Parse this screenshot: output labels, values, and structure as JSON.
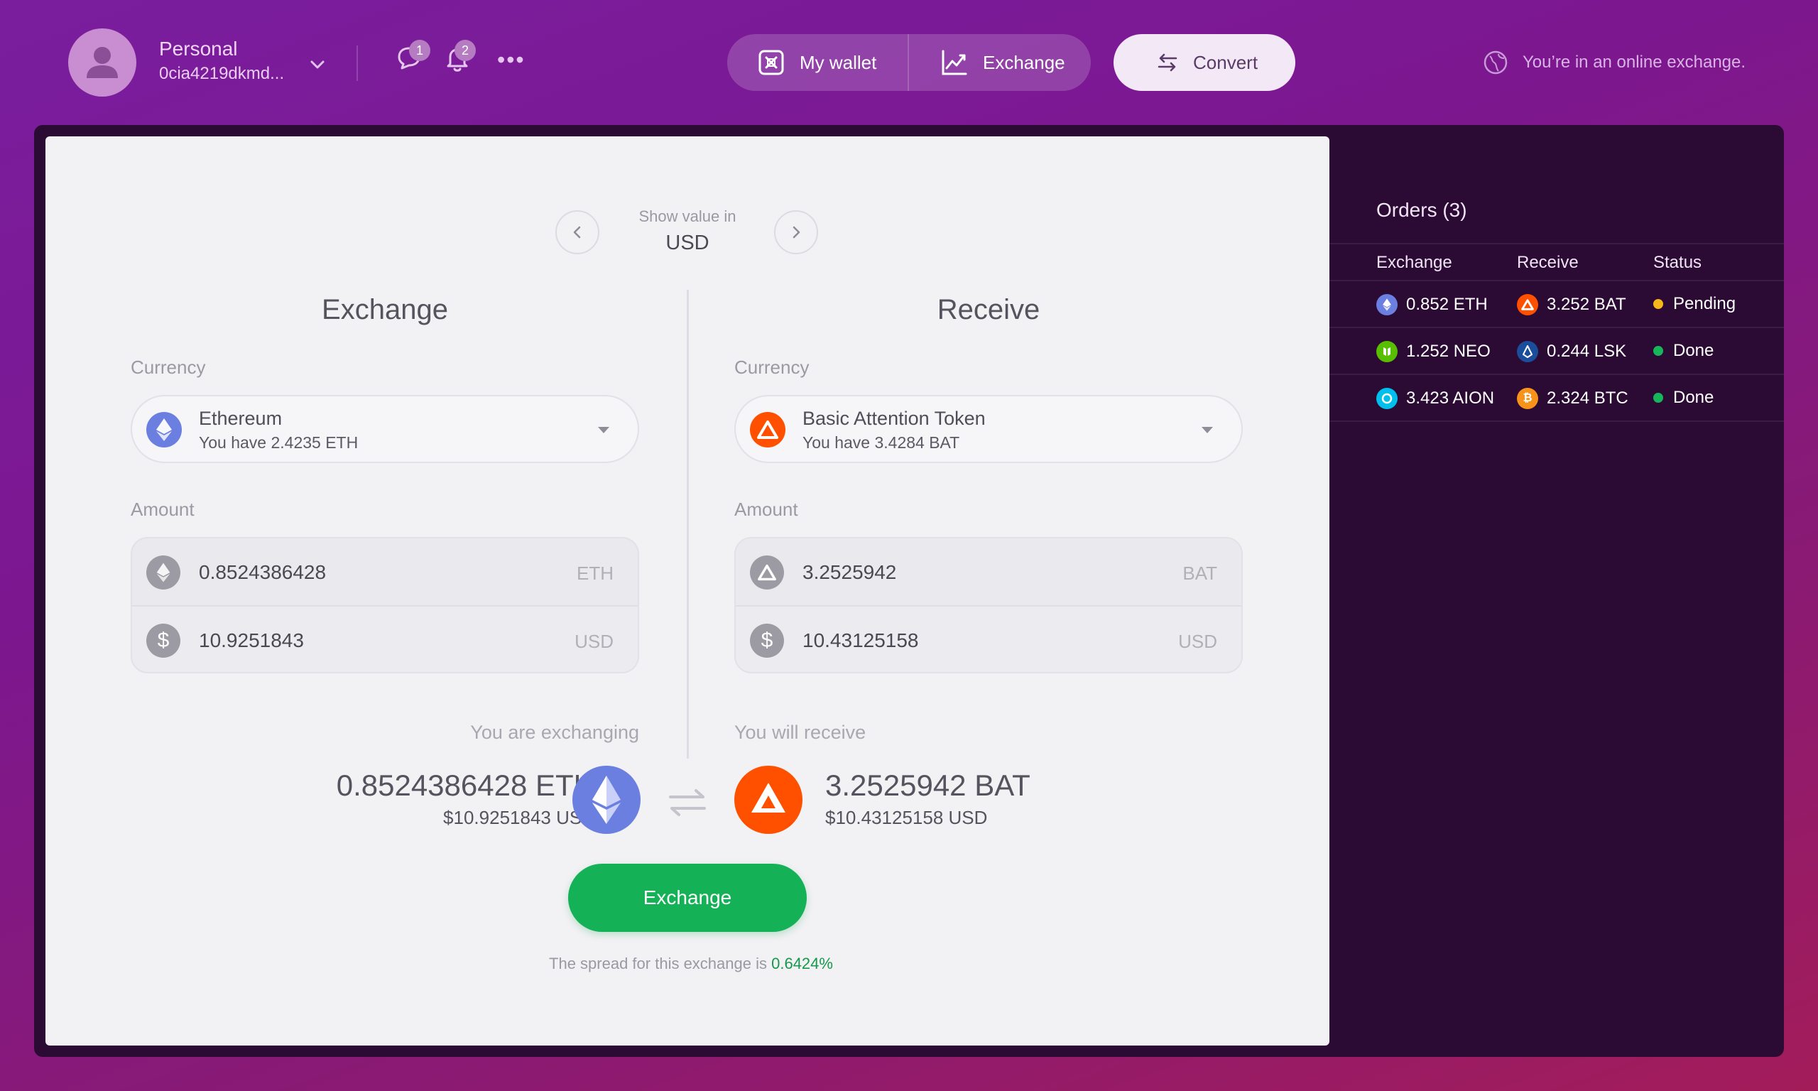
{
  "header": {
    "account_name": "Personal",
    "account_address": "0cia4219dkmd...",
    "messages_badge": "1",
    "notifications_badge": "2",
    "more_label": "•••",
    "nav": {
      "wallet_label": "My wallet",
      "exchange_label": "Exchange",
      "convert_label": "Convert"
    },
    "online_status": "You’re in an online exchange."
  },
  "converter": {
    "show_value_label": "Show value in",
    "show_value_currency": "USD",
    "exchange_side": {
      "title": "Exchange",
      "currency_label": "Currency",
      "currency_name": "Ethereum",
      "currency_balance": "You have 2.4235 ETH",
      "amount_label": "Amount",
      "amount_crypto": "0.8524386428",
      "amount_crypto_unit": "ETH",
      "amount_fiat": "10.9251843",
      "amount_fiat_unit": "USD",
      "summary_label": "You are exchanging",
      "summary_amount": "0.8524386428 ETH",
      "summary_fiat": "$10.9251843 USD"
    },
    "receive_side": {
      "title": "Receive",
      "currency_label": "Currency",
      "currency_name": "Basic Attention Token",
      "currency_balance": "You have 3.4284 BAT",
      "amount_label": "Amount",
      "amount_crypto": "3.2525942",
      "amount_crypto_unit": "BAT",
      "amount_fiat": "10.43125158",
      "amount_fiat_unit": "USD",
      "summary_label": "You will receive",
      "summary_amount": "3.2525942 BAT",
      "summary_fiat": "$10.43125158 USD"
    },
    "exchange_button": "Exchange",
    "spread_text": "The spread for this exchange is",
    "spread_value": "0.6424%"
  },
  "orders": {
    "title": "Orders (3)",
    "columns": [
      "Exchange",
      "Receive",
      "Status"
    ],
    "rows": [
      {
        "exchange": "0.852 ETH",
        "exchange_icon": "eth-icon",
        "exchange_color": "#6b7fe0",
        "receive": "3.252 BAT",
        "receive_icon": "bat-icon",
        "receive_color": "#ff5000",
        "status": "Pending",
        "status_color": "#f5b81b"
      },
      {
        "exchange": "1.252 NEO",
        "exchange_icon": "neo-icon",
        "exchange_color": "#58bf00",
        "receive": "0.244 LSK",
        "receive_icon": "lsk-icon",
        "receive_color": "#1a4e9b",
        "status": "Done",
        "status_color": "#18b65a"
      },
      {
        "exchange": "3.423 AION",
        "exchange_icon": "aion-icon",
        "exchange_color": "#00bfec",
        "receive": "2.324 BTC",
        "receive_icon": "btc-icon",
        "receive_color": "#f7931a",
        "status": "Done",
        "status_color": "#18b65a"
      }
    ]
  },
  "colors": {
    "accent_green": "#14b156",
    "eth": "#6b7fe0",
    "bat": "#ff5000",
    "panel_bg": "#2b0a34"
  }
}
